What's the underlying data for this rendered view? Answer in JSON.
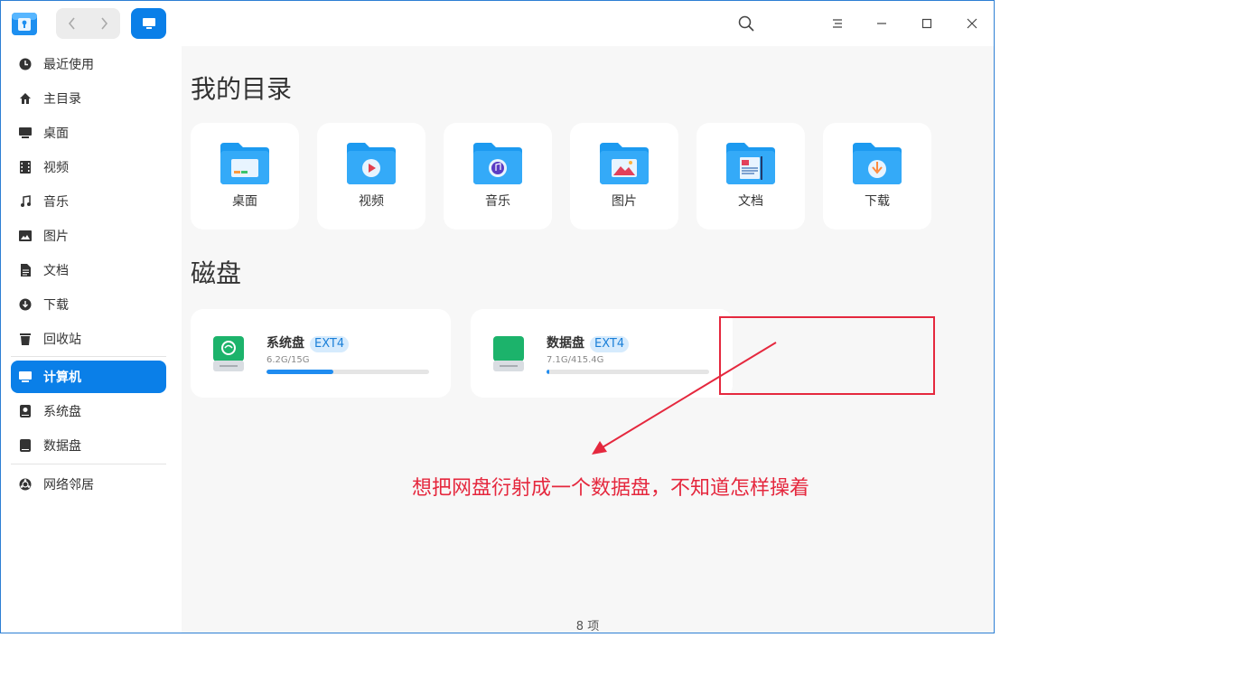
{
  "sidebar": {
    "items": [
      {
        "label": "最近使用",
        "icon": "clock-icon"
      },
      {
        "label": "主目录",
        "icon": "home-icon"
      },
      {
        "label": "桌面",
        "icon": "desktop-icon"
      },
      {
        "label": "视频",
        "icon": "film-icon"
      },
      {
        "label": "音乐",
        "icon": "music-note-icon"
      },
      {
        "label": "图片",
        "icon": "image-icon"
      },
      {
        "label": "文档",
        "icon": "document-icon"
      },
      {
        "label": "下载",
        "icon": "download-icon"
      },
      {
        "label": "回收站",
        "icon": "trash-icon"
      },
      {
        "label": "计算机",
        "icon": "computer-icon",
        "active": true
      },
      {
        "label": "系统盘",
        "icon": "drive-icon"
      },
      {
        "label": "数据盘",
        "icon": "drive-icon"
      },
      {
        "label": "网络邻居",
        "icon": "network-icon"
      }
    ]
  },
  "main": {
    "my_dirs_title": "我的目录",
    "folders": [
      {
        "label": "桌面",
        "icon": "desktop-folder-icon"
      },
      {
        "label": "视频",
        "icon": "video-folder-icon"
      },
      {
        "label": "音乐",
        "icon": "music-folder-icon"
      },
      {
        "label": "图片",
        "icon": "pictures-folder-icon"
      },
      {
        "label": "文档",
        "icon": "documents-folder-icon"
      },
      {
        "label": "下载",
        "icon": "downloads-folder-icon"
      }
    ],
    "disks_title": "磁盘",
    "disks": [
      {
        "name": "系统盘",
        "fs": "EXT4",
        "size": "6.2G/15G",
        "usage": 0.41,
        "color": "#1cb36b"
      },
      {
        "name": "数据盘",
        "fs": "EXT4",
        "size": "7.1G/415.4G",
        "usage": 0.017,
        "color": "#1cb36b"
      }
    ],
    "status": "8 项"
  },
  "annotation": {
    "text": "想把网盘衍射成一个数据盘，不知道怎样操着",
    "color": "#e5283e"
  },
  "colors": {
    "accent": "#0a7fe8",
    "folder_blue": "#1c9af0"
  }
}
